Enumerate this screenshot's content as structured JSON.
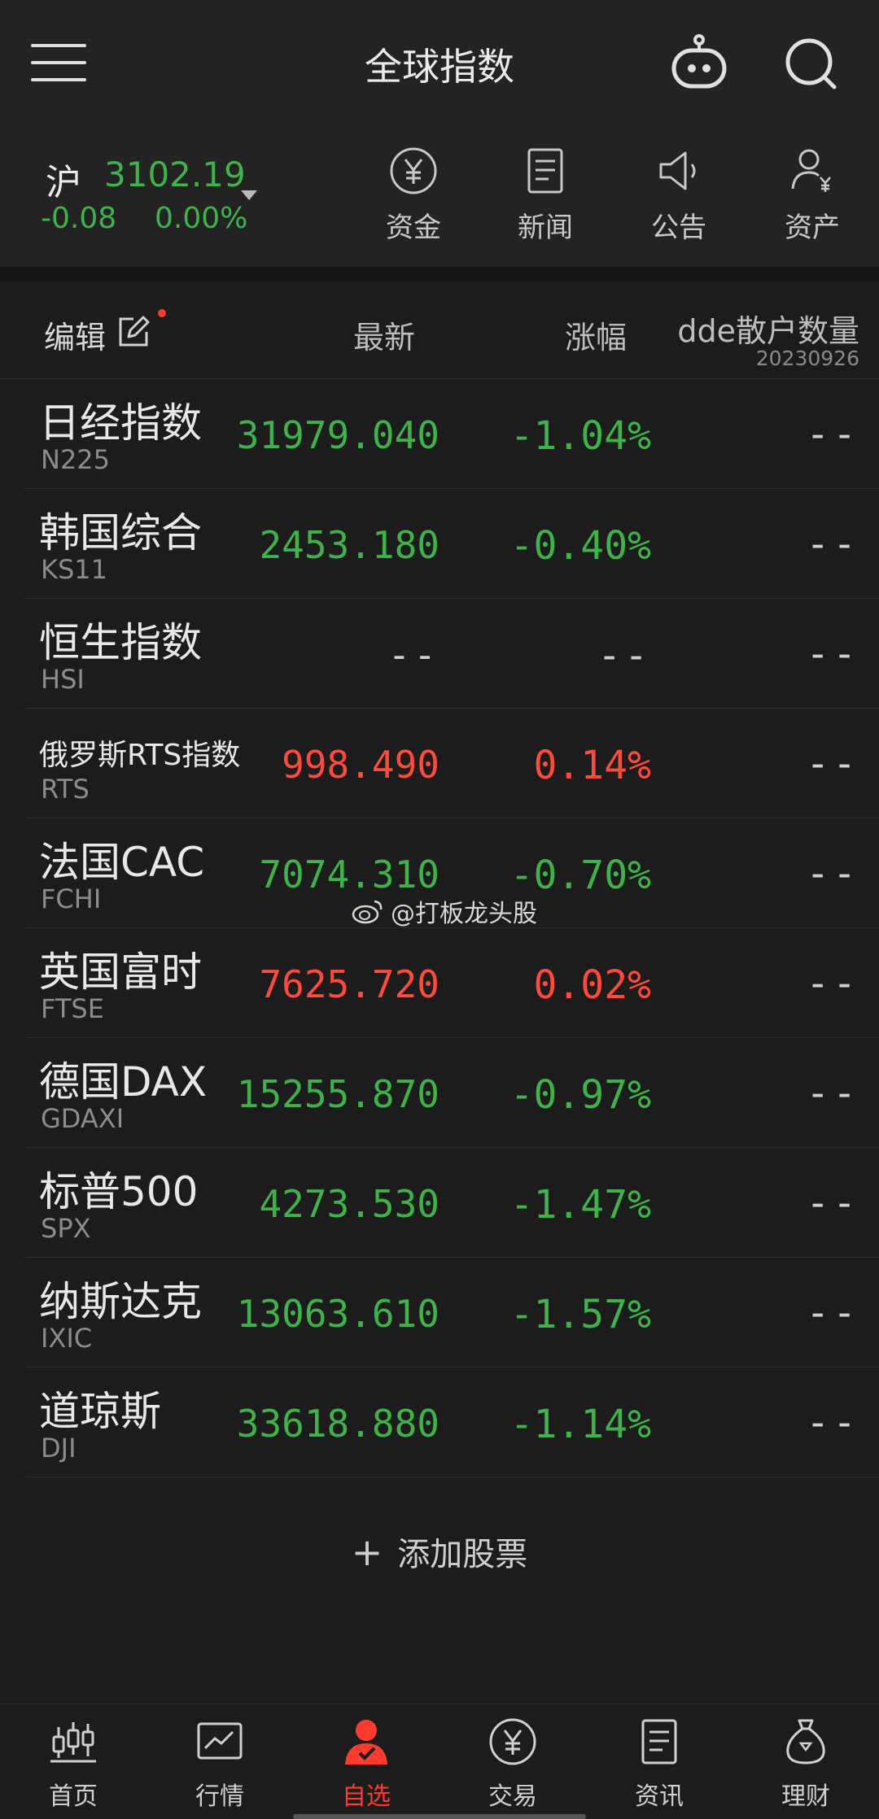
{
  "header": {
    "title": "全球指数"
  },
  "market": {
    "name": "沪",
    "value": "3102.19",
    "change": "-0.08",
    "change_pct": "0.00%"
  },
  "quick_actions": [
    {
      "label": "资金",
      "icon": "yuan-circle-icon"
    },
    {
      "label": "新闻",
      "icon": "news-document-icon"
    },
    {
      "label": "公告",
      "icon": "speaker-icon"
    },
    {
      "label": "资产",
      "icon": "user-asset-icon"
    }
  ],
  "columns": {
    "edit": "编辑",
    "latest": "最新",
    "change": "涨幅",
    "dde": "dde散户数量",
    "dde_date": "20230926"
  },
  "rows": [
    {
      "name": "日经指数",
      "code": "N225",
      "price": "31979.040",
      "pct": "-1.04%",
      "dde": "--",
      "color": "#3fb24a"
    },
    {
      "name": "韩国综合",
      "code": "KS11",
      "price": "2453.180",
      "pct": "-0.40%",
      "dde": "--",
      "color": "#3fb24a"
    },
    {
      "name": "恒生指数",
      "code": "HSI",
      "price": "--",
      "pct": "--",
      "dde": "--",
      "color": "#cfcfcf"
    },
    {
      "name": "俄罗斯RTS指数",
      "code": "RTS",
      "price": "998.490",
      "pct": "0.14%",
      "dde": "--",
      "color": "#ff4a3d"
    },
    {
      "name": "法国CAC",
      "code": "FCHI",
      "price": "7074.310",
      "pct": "-0.70%",
      "dde": "--",
      "color": "#3fb24a"
    },
    {
      "name": "英国富时",
      "code": "FTSE",
      "price": "7625.720",
      "pct": "0.02%",
      "dde": "--",
      "color": "#ff4a3d"
    },
    {
      "name": "德国DAX",
      "code": "GDAXI",
      "price": "15255.870",
      "pct": "-0.97%",
      "dde": "--",
      "color": "#3fb24a"
    },
    {
      "name": "标普500",
      "code": "SPX",
      "price": "4273.530",
      "pct": "-1.47%",
      "dde": "--",
      "color": "#3fb24a"
    },
    {
      "name": "纳斯达克",
      "code": "IXIC",
      "price": "13063.610",
      "pct": "-1.57%",
      "dde": "--",
      "color": "#3fb24a"
    },
    {
      "name": "道琼斯",
      "code": "DJI",
      "price": "33618.880",
      "pct": "-1.14%",
      "dde": "--",
      "color": "#3fb24a"
    }
  ],
  "watermark": "@打板龙头股",
  "add_stock": {
    "plus": "+",
    "label": "添加股票"
  },
  "tabs": [
    {
      "label": "首页",
      "icon": "candlestick-icon"
    },
    {
      "label": "行情",
      "icon": "chart-line-icon"
    },
    {
      "label": "自选",
      "icon": "user-check-icon"
    },
    {
      "label": "交易",
      "icon": "yuan-circle-icon"
    },
    {
      "label": "资讯",
      "icon": "news-document-icon"
    },
    {
      "label": "理财",
      "icon": "money-bag-icon"
    }
  ],
  "colors": {
    "up": "#ff4a3d",
    "down": "#3fb24a",
    "active_tab": "#ff3b30"
  }
}
